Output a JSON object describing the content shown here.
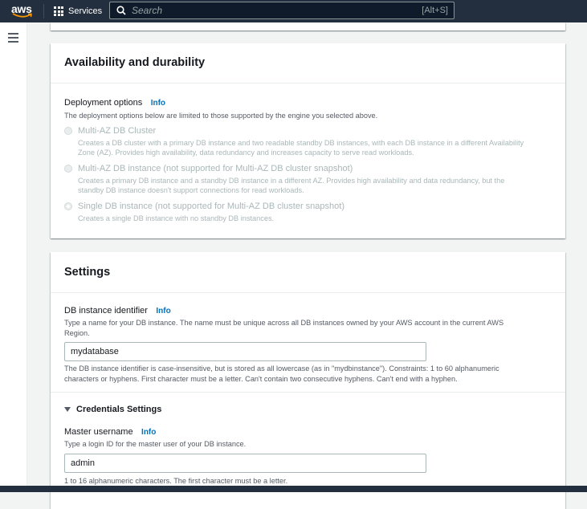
{
  "nav": {
    "logo_text": "aws",
    "services_label": "Services",
    "search_placeholder": "Search",
    "search_shortcut": "[Alt+S]"
  },
  "availability": {
    "title": "Availability and durability",
    "deployment_label": "Deployment options",
    "info": "Info",
    "deployment_desc": "The deployment options below are limited to those supported by the engine you selected above.",
    "options": [
      {
        "label": "Multi-AZ DB Cluster",
        "desc_line1": "Creates a DB cluster with a primary DB instance and two readable standby DB instances, with each DB instance in a different Availability",
        "desc_line2": "Zone (AZ). Provides high availability, data redundancy and increases capacity to serve read workloads.",
        "checked": false
      },
      {
        "label": "Multi-AZ DB instance (not supported for Multi-AZ DB cluster snapshot)",
        "desc_line1": "Creates a primary DB instance and a standby DB instance in a different AZ. Provides high availability and data redundancy, but the",
        "desc_line2": "standby DB instance doesn't support connections for read workloads.",
        "checked": false
      },
      {
        "label": "Single DB instance (not supported for Multi-AZ DB cluster snapshot)",
        "desc_line1": "Creates a single DB instance with no standby DB instances.",
        "checked": true
      }
    ]
  },
  "settings": {
    "title": "Settings",
    "db_identifier": {
      "label": "DB instance identifier",
      "info": "Info",
      "desc_line1": "Type a name for your DB instance. The name must be unique across all DB instances owned by your AWS account in the current AWS",
      "desc_line2": "Region.",
      "value": "mydatabase",
      "constraint_line1": "The DB instance identifier is case-insensitive, but is stored as all lowercase (as in \"mydbinstance\"). Constraints: 1 to 60 alphanumeric",
      "constraint_line2": "characters or hyphens. First character must be a letter. Can't contain two consecutive hyphens. Can't end with a hyphen."
    },
    "credentials": {
      "title": "Credentials Settings",
      "username_label": "Master username",
      "info": "Info",
      "username_desc": "Type a login ID for the master user of your DB instance.",
      "username_value": "admin",
      "username_constraint": "1 to 16 alphanumeric characters. The first character must be a letter."
    }
  },
  "colors": {
    "nav_bg": "#232f3e",
    "link": "#0073bb",
    "page_bg": "#f2f3f3",
    "aws_orange": "#ff9900"
  }
}
